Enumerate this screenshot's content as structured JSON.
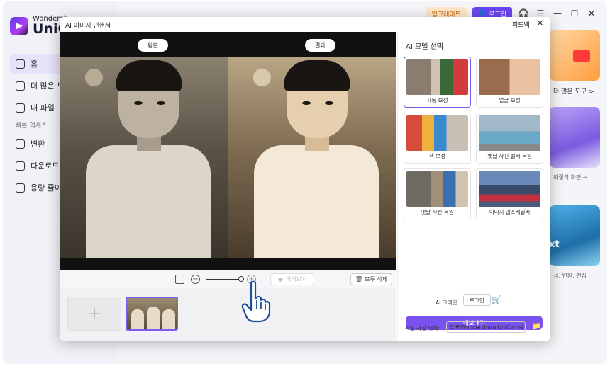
{
  "app": {
    "brand": "Wondersh",
    "name": "UniCo",
    "upgrade_label": "업그레이드",
    "login_label": "로그인"
  },
  "sidebar": {
    "items": [
      {
        "label": "홈",
        "icon": "home-icon",
        "active": true
      },
      {
        "label": "더 많은 도",
        "icon": "toolbox-icon",
        "active": false
      },
      {
        "label": "내 파일",
        "icon": "file-icon",
        "active": false
      }
    ],
    "section_label": "빠른 액세스",
    "quick_items": [
      {
        "label": "변환",
        "icon": "convert-icon"
      },
      {
        "label": "다운로드",
        "icon": "download-icon"
      },
      {
        "label": "용량 줄이",
        "icon": "compress-icon"
      }
    ]
  },
  "right_cards": {
    "more_tools_label": "더 많은 도구 >",
    "card2_caption": "화질의 화면 녹",
    "card3_caption": "성, 변환, 편집",
    "card3_text": "xt"
  },
  "dialog": {
    "title": "AI 이미지 인핸서",
    "feedback_label": "피드백",
    "close_icon": "close-icon",
    "preview": {
      "original_label": "원본",
      "result_label": "결과"
    },
    "toolbar": {
      "preview_label": "미리보기",
      "delete_all_label": "모두 삭제"
    },
    "panel": {
      "title": "AI 모델 선택",
      "models": [
        {
          "label": "자동 보정",
          "selected": true
        },
        {
          "label": "얼굴 보정",
          "selected": false
        },
        {
          "label": "색 보정",
          "selected": false
        },
        {
          "label": "옛날 사진 컬러 복원",
          "selected": false
        },
        {
          "label": "옛날 사진 복원",
          "selected": false
        },
        {
          "label": "이미지 업스케일러",
          "selected": false
        }
      ],
      "credits_label": "AI 크레딧:",
      "credits_login": "로그인",
      "export_label": "내보내기",
      "save_location_label": "파일 저장 위치:",
      "save_path": "D:₩Wondershare UniConve"
    }
  },
  "colors": {
    "accent": "#7a52f0",
    "upgrade_bg": "#ffe6c9"
  }
}
